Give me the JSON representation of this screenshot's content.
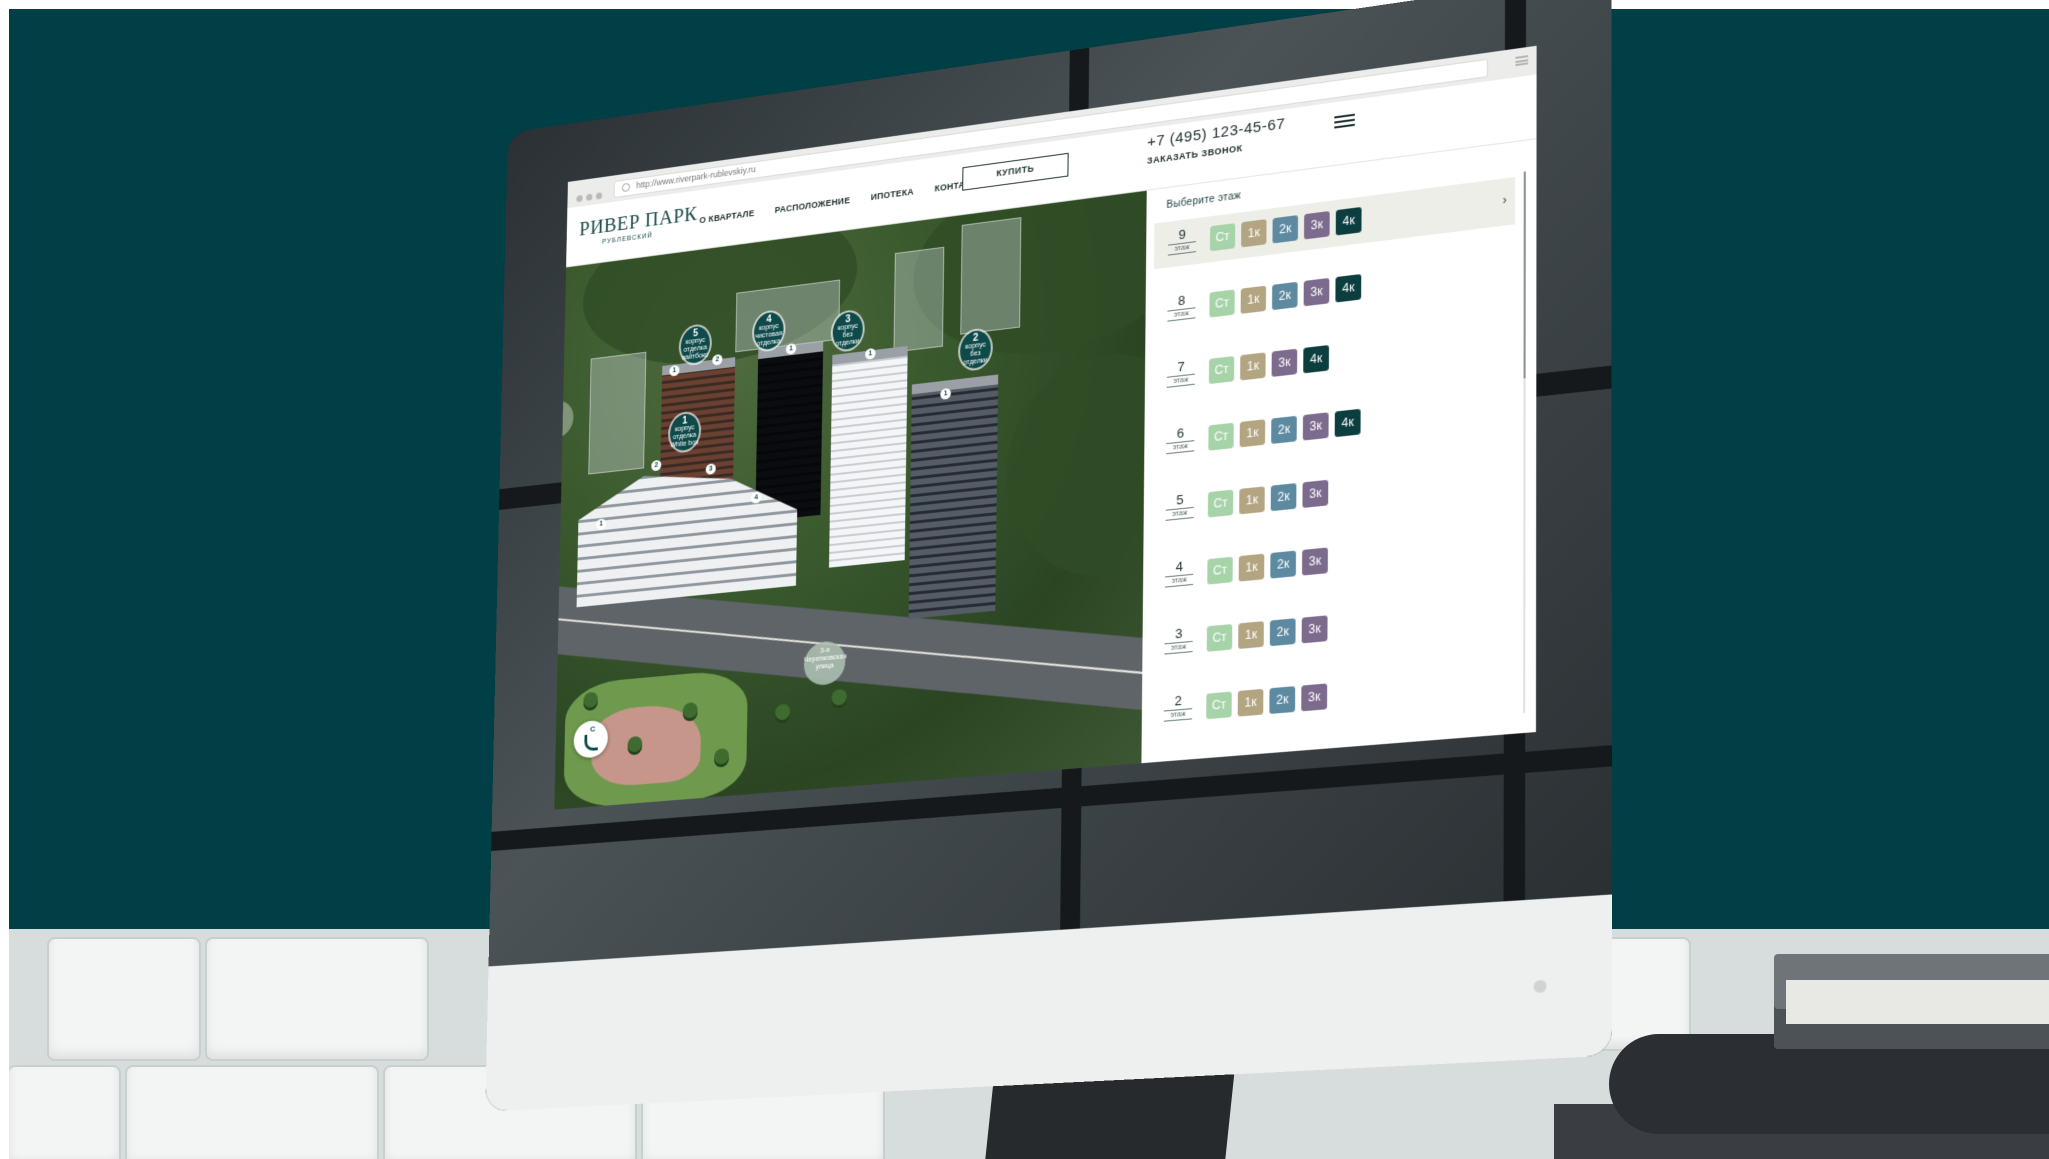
{
  "browser": {
    "url": "http://www.riverpark-rublevskiy.ru"
  },
  "header": {
    "logo_main": "РИВЕР ПАРК",
    "logo_sub": "РУБЛЕВСКИЙ",
    "nav": [
      "О КВАРТАЛЕ",
      "РАСПОЛОЖЕНИЕ",
      "ИПОТЕКА",
      "КОНТАКТЫ"
    ],
    "buy_label": "КУПИТЬ",
    "phone": "+7 (495) 123-45-67",
    "callback_label": "ЗАКАЗАТЬ ЗВОНОК"
  },
  "map": {
    "buildings": [
      {
        "num": "5",
        "word": "корпус",
        "sub": "отделка вайтбокс"
      },
      {
        "num": "4",
        "word": "корпус",
        "sub": "чистовая отделка"
      },
      {
        "num": "3",
        "word": "корпус",
        "sub": "без отделки"
      },
      {
        "num": "2",
        "word": "корпус",
        "sub": "без отделки"
      },
      {
        "num": "1",
        "word": "корпус",
        "sub": "отделка White box"
      }
    ],
    "entrances": [
      "1",
      "2",
      "1",
      "1",
      "1",
      "2",
      "3",
      "4",
      "1"
    ],
    "street": "3-я Черепковская улица",
    "compass_label": "С"
  },
  "floors": {
    "title": "Выберите этаж",
    "floor_word": "этаж",
    "arrow": "›",
    "type_colors": {
      "Ст": "#a7d3a9",
      "1к": "#b3a582",
      "2к": "#5d8aa0",
      "3к": "#7d6b8e",
      "4к": "#0c3e40"
    },
    "rows": [
      {
        "num": "9",
        "types": [
          "Ст",
          "1к",
          "2к",
          "3к",
          "4к"
        ]
      },
      {
        "num": "8",
        "types": [
          "Ст",
          "1к",
          "2к",
          "3к",
          "4к"
        ]
      },
      {
        "num": "7",
        "types": [
          "Ст",
          "1к",
          "3к",
          "4к"
        ]
      },
      {
        "num": "6",
        "types": [
          "Ст",
          "1к",
          "2к",
          "3к",
          "4к"
        ]
      },
      {
        "num": "5",
        "types": [
          "Ст",
          "1к",
          "2к",
          "3к"
        ]
      },
      {
        "num": "4",
        "types": [
          "Ст",
          "1к",
          "2к",
          "3к"
        ]
      },
      {
        "num": "3",
        "types": [
          "Ст",
          "1к",
          "2к",
          "3к"
        ]
      },
      {
        "num": "2",
        "types": [
          "Ст",
          "1к",
          "2к",
          "3к"
        ]
      }
    ]
  }
}
